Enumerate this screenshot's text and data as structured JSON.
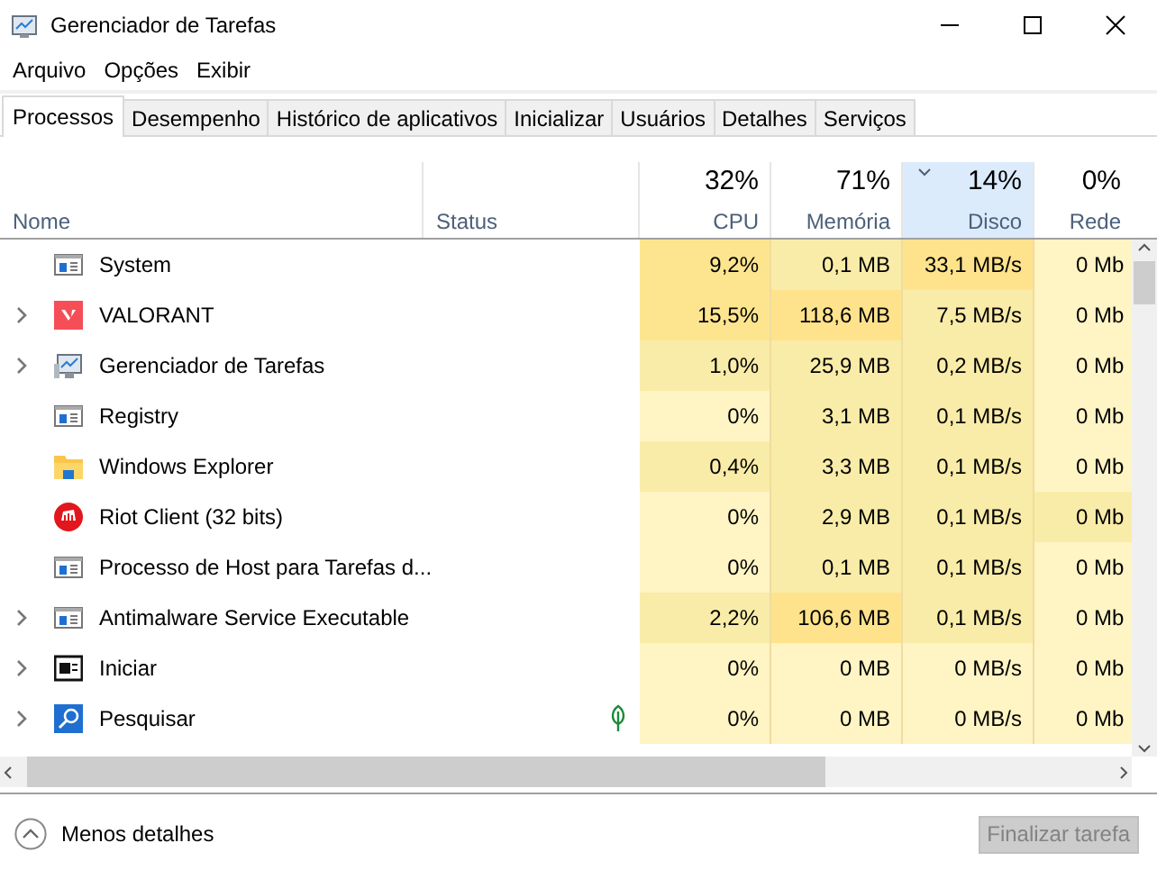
{
  "window": {
    "title": "Gerenciador de Tarefas"
  },
  "menu": [
    "Arquivo",
    "Opções",
    "Exibir"
  ],
  "tabs": [
    {
      "label": "Processos",
      "selected": true
    },
    {
      "label": "Desempenho",
      "selected": false
    },
    {
      "label": "Histórico de aplicativos",
      "selected": false
    },
    {
      "label": "Inicializar",
      "selected": false
    },
    {
      "label": "Usuários",
      "selected": false
    },
    {
      "label": "Detalhes",
      "selected": false
    },
    {
      "label": "Serviços",
      "selected": false
    }
  ],
  "table": {
    "columns": [
      {
        "label": "Nome",
        "kind": "text",
        "selected": false
      },
      {
        "label": "Status",
        "kind": "text",
        "selected": false
      },
      {
        "label": "CPU",
        "total": "32%",
        "kind": "metric",
        "selected": false
      },
      {
        "label": "Memória",
        "total": "71%",
        "kind": "metric",
        "selected": false
      },
      {
        "label": "Disco",
        "total": "14%",
        "kind": "metric",
        "selected": true
      },
      {
        "label": "Rede",
        "total": "0%",
        "kind": "metric",
        "selected": false
      }
    ],
    "rows": [
      {
        "kind": "system",
        "expandable": false,
        "efficiency": false,
        "cells": [
          {
            "text": "System"
          },
          {
            "text": ""
          },
          {
            "text": "9,2%",
            "color": "#fde58f"
          },
          {
            "text": "0,1 MB",
            "color": "#f9eca8"
          },
          {
            "text": "33,1 MB/s",
            "color": "#ffe38c"
          },
          {
            "text": "0 Mb",
            "color": "#fff4c4"
          }
        ]
      },
      {
        "kind": "game",
        "expandable": true,
        "efficiency": false,
        "cells": [
          {
            "text": "VALORANT"
          },
          {
            "text": ""
          },
          {
            "text": "15,5%",
            "color": "#fde58f"
          },
          {
            "text": "118,6 MB",
            "color": "#ffe38c"
          },
          {
            "text": "7,5 MB/s",
            "color": "#f9eca8"
          },
          {
            "text": "0 Mb",
            "color": "#fff4c4"
          }
        ]
      },
      {
        "kind": "monitor",
        "expandable": true,
        "efficiency": false,
        "cells": [
          {
            "text": "Gerenciador de Tarefas"
          },
          {
            "text": ""
          },
          {
            "text": "1,0%",
            "color": "#f9eca8"
          },
          {
            "text": "25,9 MB",
            "color": "#f9eca8"
          },
          {
            "text": "0,2 MB/s",
            "color": "#f9eca8"
          },
          {
            "text": "0 Mb",
            "color": "#fff4c4"
          }
        ]
      },
      {
        "kind": "system",
        "expandable": false,
        "efficiency": false,
        "cells": [
          {
            "text": "Registry"
          },
          {
            "text": ""
          },
          {
            "text": "0%",
            "color": "#fff4c4"
          },
          {
            "text": "3,1 MB",
            "color": "#f9eca8"
          },
          {
            "text": "0,1 MB/s",
            "color": "#f9eca8"
          },
          {
            "text": "0 Mb",
            "color": "#fff4c4"
          }
        ]
      },
      {
        "kind": "folder",
        "expandable": false,
        "efficiency": false,
        "cells": [
          {
            "text": "Windows Explorer"
          },
          {
            "text": ""
          },
          {
            "text": "0,4%",
            "color": "#f9eca8"
          },
          {
            "text": "3,3 MB",
            "color": "#f9eca8"
          },
          {
            "text": "0,1 MB/s",
            "color": "#f9eca8"
          },
          {
            "text": "0 Mb",
            "color": "#fff4c4"
          }
        ]
      },
      {
        "kind": "client",
        "expandable": false,
        "efficiency": false,
        "cells": [
          {
            "text": "Riot Client (32 bits)"
          },
          {
            "text": ""
          },
          {
            "text": "0%",
            "color": "#fff4c4"
          },
          {
            "text": "2,9 MB",
            "color": "#f9eca8"
          },
          {
            "text": "0,1 MB/s",
            "color": "#f9eca8"
          },
          {
            "text": "0 Mb",
            "color": "#f9eca8"
          }
        ]
      },
      {
        "kind": "system",
        "expandable": false,
        "efficiency": false,
        "cells": [
          {
            "text": "Processo de Host para Tarefas d..."
          },
          {
            "text": ""
          },
          {
            "text": "0%",
            "color": "#fff4c4"
          },
          {
            "text": "0,1 MB",
            "color": "#f9eca8"
          },
          {
            "text": "0,1 MB/s",
            "color": "#f9eca8"
          },
          {
            "text": "0 Mb",
            "color": "#fff4c4"
          }
        ]
      },
      {
        "kind": "system",
        "expandable": true,
        "efficiency": false,
        "cells": [
          {
            "text": "Antimalware Service Executable"
          },
          {
            "text": ""
          },
          {
            "text": "2,2%",
            "color": "#f9eca8"
          },
          {
            "text": "106,6 MB",
            "color": "#ffe38c"
          },
          {
            "text": "0,1 MB/s",
            "color": "#f9eca8"
          },
          {
            "text": "0 Mb",
            "color": "#fff4c4"
          }
        ]
      },
      {
        "kind": "start",
        "expandable": true,
        "efficiency": false,
        "cells": [
          {
            "text": "Iniciar"
          },
          {
            "text": ""
          },
          {
            "text": "0%",
            "color": "#fff4c4"
          },
          {
            "text": "0 MB",
            "color": "#fff4c4"
          },
          {
            "text": "0 MB/s",
            "color": "#fff4c4"
          },
          {
            "text": "0 Mb",
            "color": "#fff4c4"
          }
        ]
      },
      {
        "kind": "search",
        "expandable": true,
        "efficiency": true,
        "cells": [
          {
            "text": "Pesquisar"
          },
          {
            "text": ""
          },
          {
            "text": "0%",
            "color": "#fff4c4"
          },
          {
            "text": "0 MB",
            "color": "#fff4c4"
          },
          {
            "text": "0 MB/s",
            "color": "#fff4c4"
          },
          {
            "text": "0 Mb",
            "color": "#fff4c4"
          }
        ]
      }
    ]
  },
  "footer": {
    "toggle": "Menos detalhes",
    "button": {
      "label": "Finalizar tarefa",
      "disabled": true
    }
  }
}
